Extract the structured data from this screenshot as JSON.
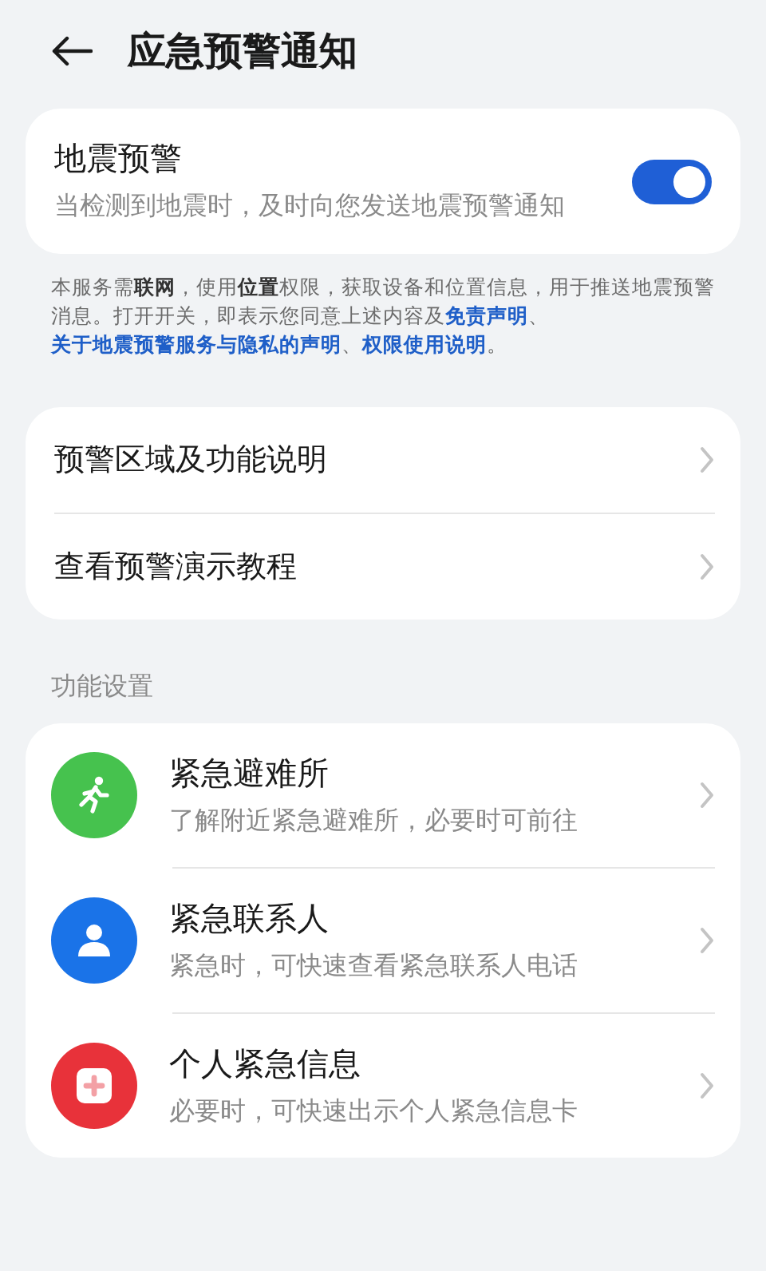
{
  "header": {
    "title": "应急预警通知"
  },
  "alert_card": {
    "title": "地震预警",
    "description": "当检测到地震时，及时向您发送地震预警通知",
    "on": true
  },
  "notice": [
    {
      "kind": "plain",
      "text": "本服务需"
    },
    {
      "kind": "bold",
      "text": "联网"
    },
    {
      "kind": "plain",
      "text": "，使用"
    },
    {
      "kind": "bold",
      "text": "位置"
    },
    {
      "kind": "plain",
      "text": "权限，获取设备和位置信息，用于推送地震预警消息。打开开关，即表示您同意上述内容及"
    },
    {
      "kind": "link",
      "text": "免责声明"
    },
    {
      "kind": "plain",
      "text": "、"
    },
    {
      "kind": "link",
      "text": "关于地震预警服务与隐私的声明"
    },
    {
      "kind": "plain",
      "text": "、"
    },
    {
      "kind": "link",
      "text": "权限使用说明"
    },
    {
      "kind": "plain",
      "text": "。"
    }
  ],
  "links": [
    {
      "label": "预警区域及功能说明"
    },
    {
      "label": "查看预警演示教程"
    }
  ],
  "section": {
    "title": "功能设置"
  },
  "features": [
    {
      "kind": "runner",
      "color": "#46c24e",
      "title": "紧急避难所",
      "subtitle": "了解附近紧急避难所，必要时可前往"
    },
    {
      "kind": "person",
      "color": "#1a73e8",
      "title": "紧急联系人",
      "subtitle": "紧急时，可快速查看紧急联系人电话"
    },
    {
      "kind": "medical",
      "color": "#e8323a",
      "title": "个人紧急信息",
      "subtitle": "必要时，可快速出示个人紧急信息卡"
    }
  ]
}
